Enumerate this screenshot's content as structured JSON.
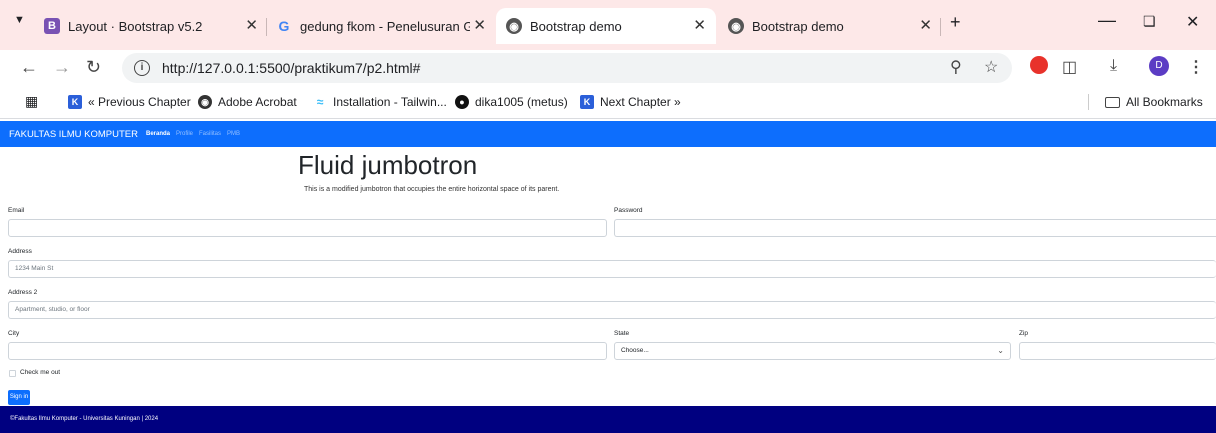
{
  "browser": {
    "tabs": [
      {
        "title": "Layout · Bootstrap v5.2",
        "icon": "bootstrap-icon"
      },
      {
        "title": "gedung fkom - Penelusuran Go",
        "icon": "google-icon"
      },
      {
        "title": "Bootstrap demo",
        "icon": "globe-icon"
      },
      {
        "title": "Bootstrap demo",
        "icon": "globe-icon"
      }
    ],
    "url": "http://127.0.0.1:5500/praktikum7/p2.html#",
    "bookmarks": [
      {
        "label": "« Previous Chapter"
      },
      {
        "label": "Adobe Acrobat"
      },
      {
        "label": "Installation - Tailwin..."
      },
      {
        "label": "dika1005 (metus)"
      },
      {
        "label": "Next Chapter »"
      }
    ],
    "all_bookmarks": "All Bookmarks",
    "profile_initial": "D"
  },
  "navbar": {
    "brand": "FAKULTAS ILMU KOMPUTER",
    "links": [
      "Beranda",
      "Profile",
      "Fasilitas",
      "PMB"
    ]
  },
  "jumbotron": {
    "title": "Fluid jumbotron",
    "lead": "This is a modified jumbotron that occupies the entire horizontal space of its parent."
  },
  "form": {
    "email_label": "Email",
    "password_label": "Password",
    "address_label": "Address",
    "address_placeholder": "1234 Main St",
    "address2_label": "Address 2",
    "address2_placeholder": "Apartment, studio, or floor",
    "city_label": "City",
    "state_label": "State",
    "state_selected": "Choose...",
    "zip_label": "Zip",
    "check_label": "Check me out",
    "submit_label": "Sign in"
  },
  "footer": {
    "text": "©Fakultas Ilmu Komputer - Universitas Kuningan | 2024"
  },
  "colors": {
    "navbar": "#0d6efd",
    "footer": "#000080",
    "tabstrip": "#fde8e8"
  }
}
